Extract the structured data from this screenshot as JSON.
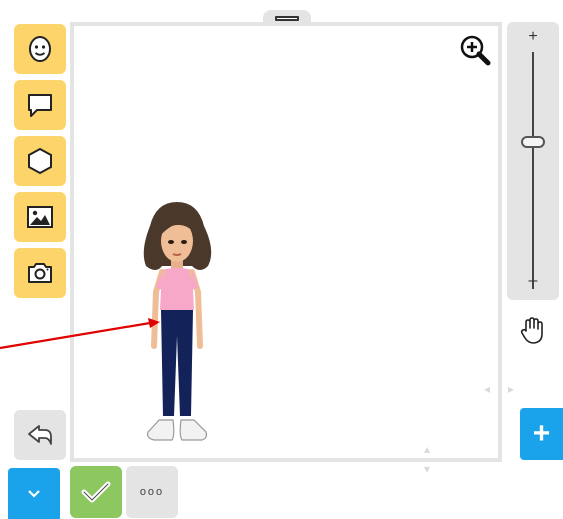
{
  "tools": [
    {
      "name": "face",
      "icon": "face-icon"
    },
    {
      "name": "speech-bubble",
      "icon": "speech-bubble-icon"
    },
    {
      "name": "hexagon",
      "icon": "hexagon-icon"
    },
    {
      "name": "image",
      "icon": "image-icon"
    },
    {
      "name": "camera",
      "icon": "camera-icon"
    }
  ],
  "zoom": {
    "plus_label": "+",
    "minus_label": "–",
    "level": 0.37
  },
  "controls": {
    "add_label": "+",
    "more_label": "ooo"
  },
  "colors": {
    "tool_yellow": "#fcd46a",
    "panel_gray": "#e4e4e4",
    "blue": "#1aa3ea",
    "green": "#8cc760",
    "arrow_red": "#e00000"
  },
  "character": {
    "shirt": "#f7a8c8",
    "pants": "#13235a",
    "hair": "#4a382b"
  }
}
